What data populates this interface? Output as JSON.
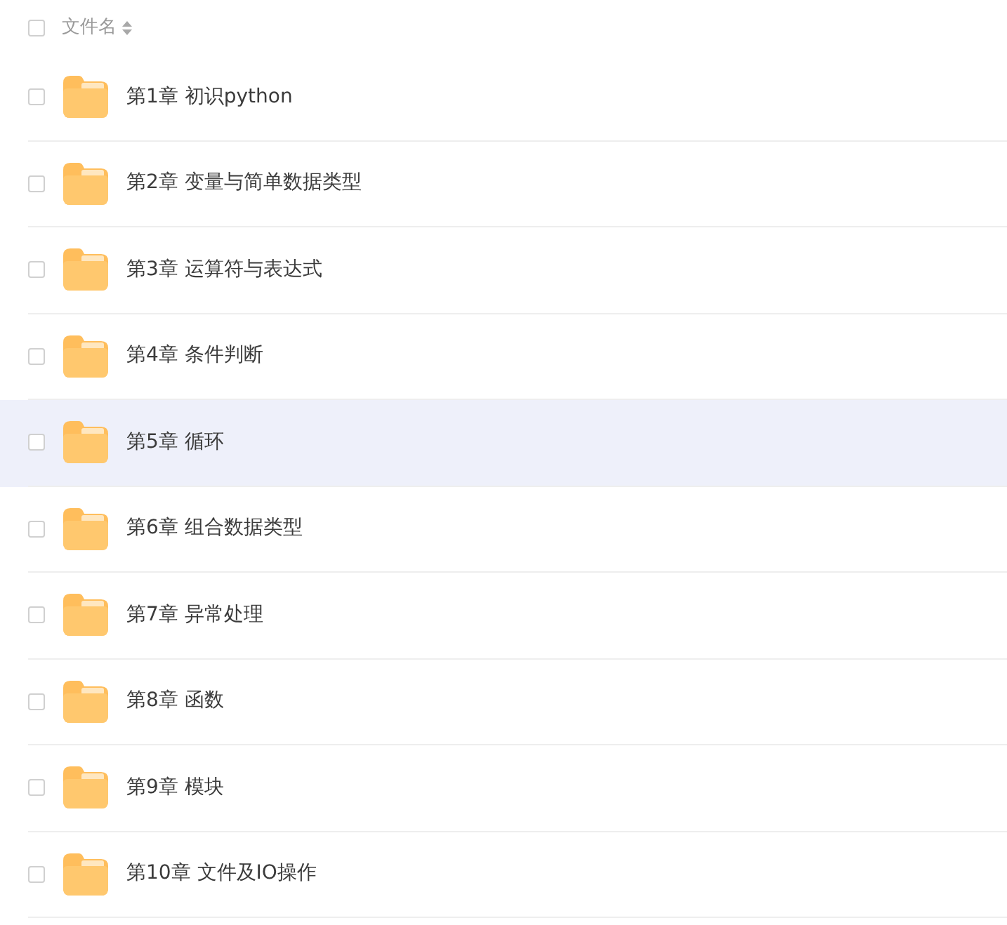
{
  "header": {
    "checked": false,
    "label": "文件名"
  },
  "rows": [
    {
      "name": "第1章 初识python",
      "checked": false,
      "hovered": false
    },
    {
      "name": "第2章 变量与简单数据类型",
      "checked": false,
      "hovered": false
    },
    {
      "name": "第3章 运算符与表达式",
      "checked": false,
      "hovered": false
    },
    {
      "name": "第4章 条件判断",
      "checked": false,
      "hovered": false
    },
    {
      "name": "第5章 循环",
      "checked": false,
      "hovered": true
    },
    {
      "name": "第6章 组合数据类型",
      "checked": false,
      "hovered": false
    },
    {
      "name": "第7章 异常处理",
      "checked": false,
      "hovered": false
    },
    {
      "name": "第8章 函数",
      "checked": false,
      "hovered": false
    },
    {
      "name": "第9章 模块",
      "checked": false,
      "hovered": false
    },
    {
      "name": "第10章 文件及IO操作",
      "checked": false,
      "hovered": false
    }
  ]
}
